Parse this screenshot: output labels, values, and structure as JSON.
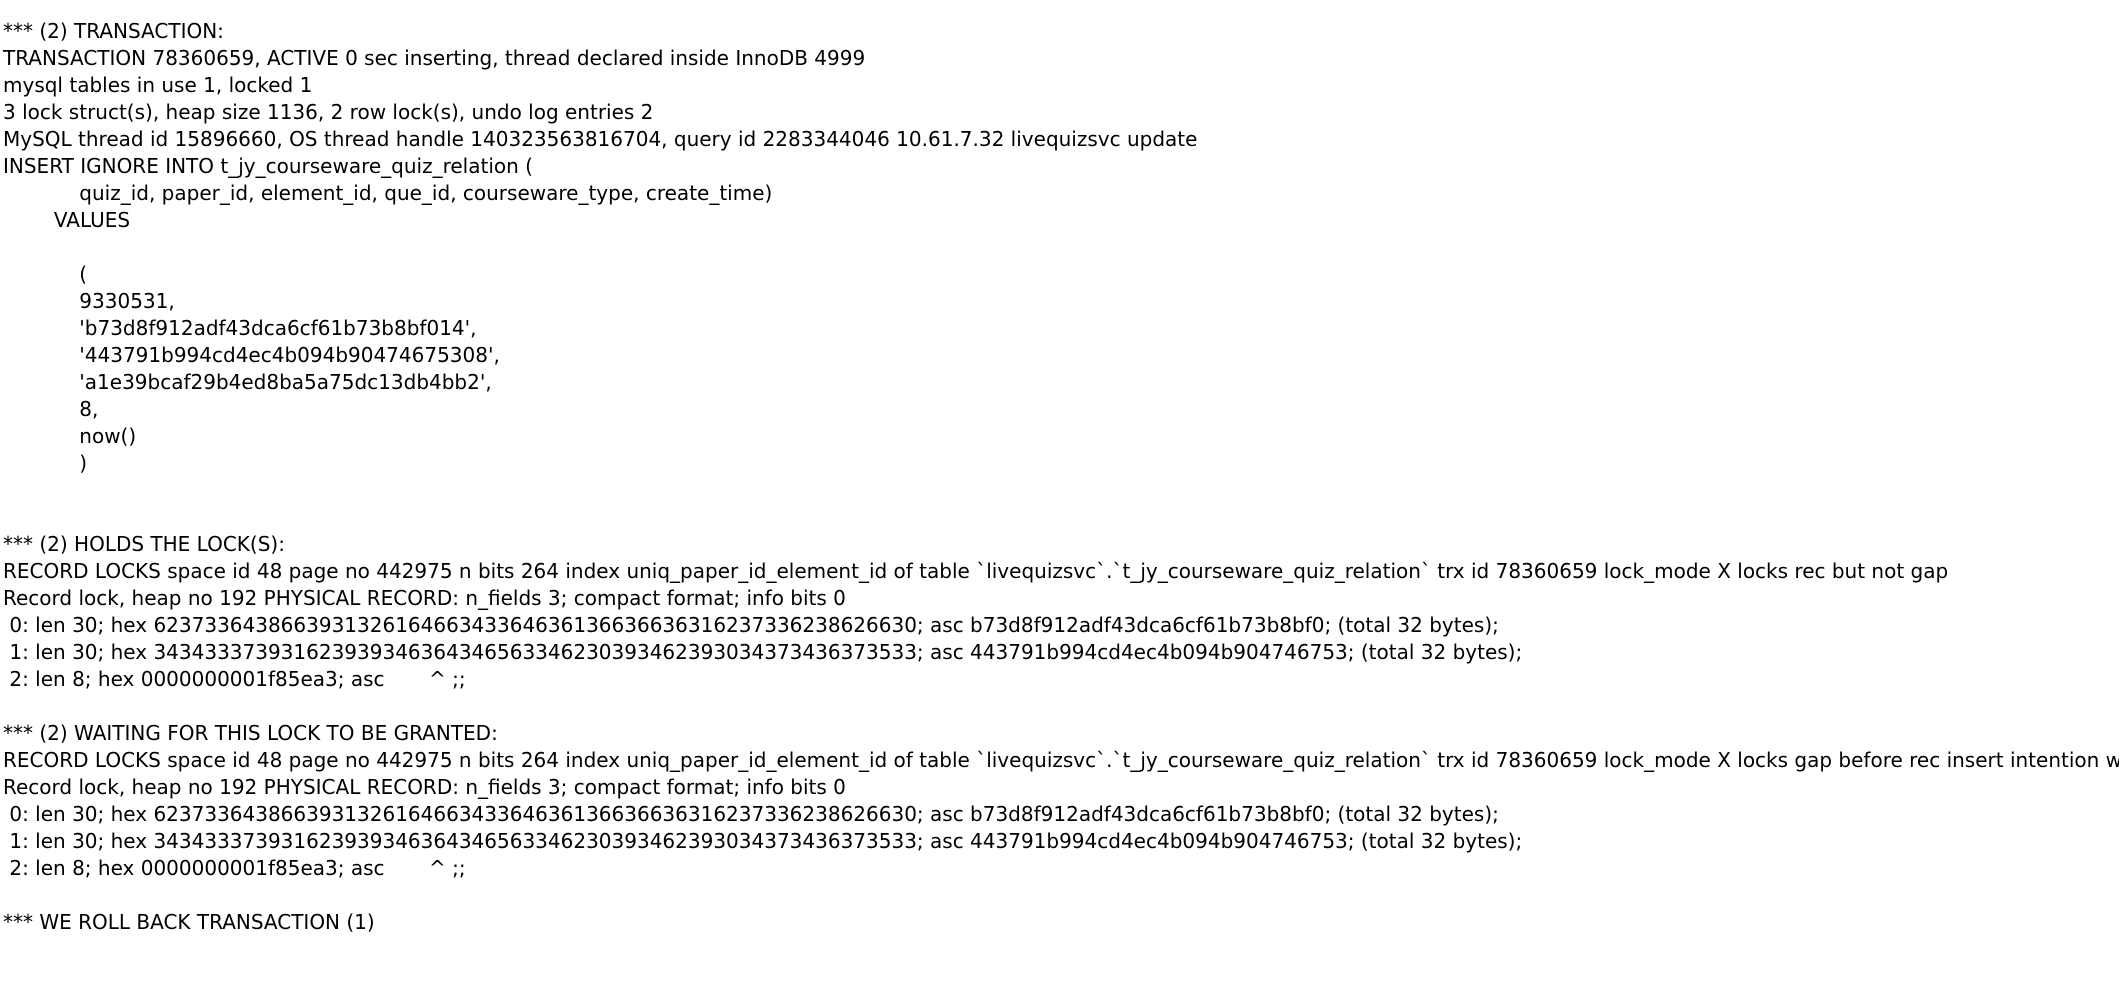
{
  "log": {
    "lines": [
      "*** (2) TRANSACTION:",
      "TRANSACTION 78360659, ACTIVE 0 sec inserting, thread declared inside InnoDB 4999",
      "mysql tables in use 1, locked 1",
      "3 lock struct(s), heap size 1136, 2 row lock(s), undo log entries 2",
      "MySQL thread id 15896660, OS thread handle 140323563816704, query id 2283344046 10.61.7.32 livequizsvc update",
      "INSERT IGNORE INTO t_jy_courseware_quiz_relation (",
      "            quiz_id, paper_id, element_id, que_id, courseware_type, create_time)",
      "        VALUES",
      "",
      "            (",
      "            9330531,",
      "            'b73d8f912adf43dca6cf61b73b8bf014',",
      "            '443791b994cd4ec4b094b90474675308',",
      "            'a1e39bcaf29b4ed8ba5a75dc13db4bb2',",
      "            8,",
      "            now()",
      "            )",
      "",
      "",
      "*** (2) HOLDS THE LOCK(S):",
      "RECORD LOCKS space id 48 page no 442975 n bits 264 index uniq_paper_id_element_id of table `livequizsvc`.`t_jy_courseware_quiz_relation` trx id 78360659 lock_mode X locks rec but not gap",
      "Record lock, heap no 192 PHYSICAL RECORD: n_fields 3; compact format; info bits 0",
      " 0: len 30; hex 623733643866393132616466343364636136636636316237336238626630; asc b73d8f912adf43dca6cf61b73b8bf0; (total 32 bytes);",
      " 1: len 30; hex 343433373931623939346364346563346230393462393034373436373533; asc 443791b994cd4ec4b094b904746753; (total 32 bytes);",
      " 2: len 8; hex 0000000001f85ea3; asc       ^ ;;",
      "",
      "*** (2) WAITING FOR THIS LOCK TO BE GRANTED:",
      "RECORD LOCKS space id 48 page no 442975 n bits 264 index uniq_paper_id_element_id of table `livequizsvc`.`t_jy_courseware_quiz_relation` trx id 78360659 lock_mode X locks gap before rec insert intention waiting",
      "Record lock, heap no 192 PHYSICAL RECORD: n_fields 3; compact format; info bits 0",
      " 0: len 30; hex 623733643866393132616466343364636136636636316237336238626630; asc b73d8f912adf43dca6cf61b73b8bf0; (total 32 bytes);",
      " 1: len 30; hex 343433373931623939346364346563346230393462393034373436373533; asc 443791b994cd4ec4b094b904746753; (total 32 bytes);",
      " 2: len 8; hex 0000000001f85ea3; asc       ^ ;;",
      "",
      "*** WE ROLL BACK TRANSACTION (1)"
    ]
  }
}
